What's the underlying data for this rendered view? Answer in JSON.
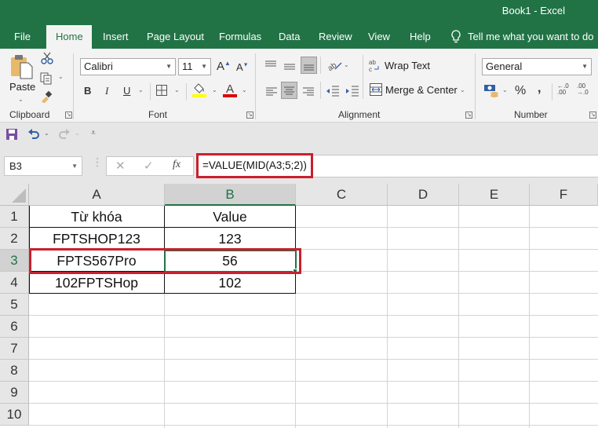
{
  "window": {
    "title": "Book1  -  Excel"
  },
  "tabs": [
    {
      "label": "File"
    },
    {
      "label": "Home",
      "active": true
    },
    {
      "label": "Insert"
    },
    {
      "label": "Page Layout"
    },
    {
      "label": "Formulas"
    },
    {
      "label": "Data"
    },
    {
      "label": "Review"
    },
    {
      "label": "View"
    },
    {
      "label": "Help"
    }
  ],
  "tell_me": "Tell me what you want to do",
  "ribbon": {
    "clipboard": {
      "label": "Clipboard",
      "paste": "Paste"
    },
    "font": {
      "label": "Font",
      "font_name": "Calibri",
      "font_size": "11",
      "bold": "B",
      "italic": "I",
      "underline": "U",
      "fill_color": "#ffff00",
      "font_color": "#e00000"
    },
    "alignment": {
      "label": "Alignment",
      "wrap_text": "Wrap Text",
      "merge_center": "Merge & Center"
    },
    "number": {
      "label": "Number",
      "format": "General",
      "percent": "%",
      "comma": ","
    }
  },
  "formula_bar": {
    "name_box": "B3",
    "formula": "=VALUE(MID(A3;5;2))",
    "cancel": "✕",
    "enter": "✓",
    "fx": "fx"
  },
  "sheet": {
    "columns": [
      "A",
      "B",
      "C",
      "D",
      "E",
      "F"
    ],
    "selected_column": "B",
    "rows": [
      "1",
      "2",
      "3",
      "4",
      "5",
      "6",
      "7",
      "8",
      "9",
      "10"
    ],
    "selected_row": "3",
    "selected_cell": "B3",
    "cells": [
      {
        "A": "Từ khóa",
        "B": "Value"
      },
      {
        "A": "FPTSHOP123",
        "B": "123"
      },
      {
        "A": "FPTS567Pro",
        "B": "56"
      },
      {
        "A": "102FPTSHop",
        "B": "102"
      }
    ]
  },
  "colors": {
    "brand": "#217346",
    "highlight": "#c8202e"
  }
}
